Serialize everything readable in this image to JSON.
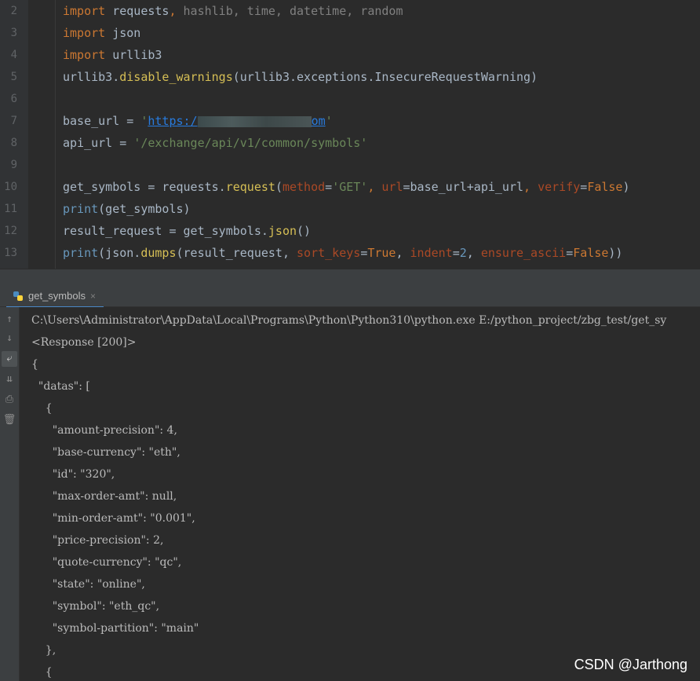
{
  "editor": {
    "lines": [
      {
        "n": "2",
        "parts": [
          {
            "t": "import",
            "c": "kw"
          },
          {
            "t": " requests",
            "c": ""
          },
          {
            "t": ",",
            "c": "kw"
          },
          {
            "t": " hashlib, time, datetime, random",
            "c": "muted"
          }
        ]
      },
      {
        "n": "3",
        "parts": [
          {
            "t": "import",
            "c": "kw"
          },
          {
            "t": " json",
            "c": ""
          }
        ]
      },
      {
        "n": "4",
        "parts": [
          {
            "t": "import",
            "c": "kw"
          },
          {
            "t": " urllib3",
            "c": ""
          }
        ]
      },
      {
        "n": "5",
        "parts": [
          {
            "t": "urllib3.",
            "c": ""
          },
          {
            "t": "disable_warnings",
            "c": "call"
          },
          {
            "t": "(urllib3.exceptions.InsecureRequestWarning)",
            "c": ""
          }
        ]
      },
      {
        "n": "6",
        "parts": []
      },
      {
        "n": "7",
        "parts": [
          {
            "t": "base_url = ",
            "c": ""
          },
          {
            "t": "'",
            "c": "str"
          },
          {
            "t": "https:/",
            "c": "url"
          },
          {
            "t": "",
            "c": "mask"
          },
          {
            "t": "om",
            "c": "url"
          },
          {
            "t": "'",
            "c": "str"
          }
        ]
      },
      {
        "n": "8",
        "parts": [
          {
            "t": "api_url = ",
            "c": ""
          },
          {
            "t": "'/exchange/api/v1/common/symbols'",
            "c": "str"
          }
        ]
      },
      {
        "n": "9",
        "parts": []
      },
      {
        "n": "10",
        "parts": [
          {
            "t": "get_symbols = requests.",
            "c": ""
          },
          {
            "t": "request",
            "c": "call"
          },
          {
            "t": "(",
            "c": ""
          },
          {
            "t": "method",
            "c": "param"
          },
          {
            "t": "=",
            "c": ""
          },
          {
            "t": "'GET'",
            "c": "str"
          },
          {
            "t": ", ",
            "c": "kw"
          },
          {
            "t": "url",
            "c": "param"
          },
          {
            "t": "=base_url+api_url",
            "c": ""
          },
          {
            "t": ", ",
            "c": "kw"
          },
          {
            "t": "verify",
            "c": "param"
          },
          {
            "t": "=",
            "c": ""
          },
          {
            "t": "False",
            "c": "kw"
          },
          {
            "t": ")",
            "c": ""
          }
        ]
      },
      {
        "n": "11",
        "parts": [
          {
            "t": "print",
            "c": "num"
          },
          {
            "t": "(get_symbols)",
            "c": ""
          }
        ]
      },
      {
        "n": "12",
        "parts": [
          {
            "t": "result_request = get_symbols.",
            "c": ""
          },
          {
            "t": "json",
            "c": "call"
          },
          {
            "t": "()",
            "c": ""
          }
        ]
      },
      {
        "n": "13",
        "parts": [
          {
            "t": "print",
            "c": "num"
          },
          {
            "t": "(json.",
            "c": ""
          },
          {
            "t": "dumps",
            "c": "call"
          },
          {
            "t": "(result_request, ",
            "c": ""
          },
          {
            "t": "sort_keys",
            "c": "param"
          },
          {
            "t": "=",
            "c": ""
          },
          {
            "t": "True",
            "c": "kw"
          },
          {
            "t": ", ",
            "c": ""
          },
          {
            "t": "indent",
            "c": "param"
          },
          {
            "t": "=",
            "c": ""
          },
          {
            "t": "2",
            "c": "num"
          },
          {
            "t": ", ",
            "c": ""
          },
          {
            "t": "ensure_ascii",
            "c": "param"
          },
          {
            "t": "=",
            "c": ""
          },
          {
            "t": "False",
            "c": "kw"
          },
          {
            "t": "))",
            "c": ""
          }
        ]
      }
    ]
  },
  "run_tab": {
    "label": "get_symbols",
    "close": "×",
    "icon": "python-icon"
  },
  "console": {
    "tools": [
      {
        "name": "up-arrow-icon",
        "glyph": "↑"
      },
      {
        "name": "down-arrow-icon",
        "glyph": "↓"
      },
      {
        "name": "soft-wrap-icon",
        "glyph": "⤶"
      },
      {
        "name": "scroll-to-end-icon",
        "glyph": "⇊"
      },
      {
        "name": "print-icon",
        "glyph": "⎙"
      },
      {
        "name": "trash-icon",
        "glyph": "🗑"
      }
    ],
    "lines": [
      "C:\\Users\\Administrator\\AppData\\Local\\Programs\\Python\\Python310\\python.exe E:/python_project/zbg_test/get_sy",
      "<Response [200]>",
      "{",
      "  \"datas\": [",
      "    {",
      "      \"amount-precision\": 4,",
      "      \"base-currency\": \"eth\",",
      "      \"id\": \"320\",",
      "      \"max-order-amt\": null,",
      "      \"min-order-amt\": \"0.001\",",
      "      \"price-precision\": 2,",
      "      \"quote-currency\": \"qc\",",
      "      \"state\": \"online\",",
      "      \"symbol\": \"eth_qc\",",
      "      \"symbol-partition\": \"main\"",
      "    },",
      "    {"
    ]
  },
  "watermark": "CSDN @Jarthong",
  "colors": {
    "background": "#2b2b2b",
    "keyword": "#cc7832",
    "string": "#6a8759",
    "url": "#287bde",
    "param": "#aa4926",
    "console_text": "#bbbbbb"
  }
}
